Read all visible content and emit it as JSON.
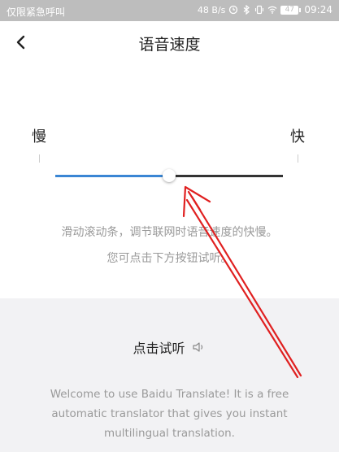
{
  "status_bar": {
    "carrier": "仅限紧急呼叫",
    "net_speed": "48 B/s",
    "battery": "47",
    "time": "09:24"
  },
  "header": {
    "title": "语音速度"
  },
  "slider": {
    "slow_label": "慢",
    "fast_label": "快",
    "value": 0.5,
    "fill_color": "#3a86d4",
    "track_color": "#333333"
  },
  "hint": {
    "line1": "滑动滚动条，调节联网时语音速度的快慢。",
    "line2": "您可点击下方按钮试听。"
  },
  "preview": {
    "button_label": "点击试听",
    "icon": "speaker-icon",
    "sample_text": "Welcome to use Baidu Translate! It is a free automatic translator that gives you instant multilingual translation."
  },
  "annotation": {
    "arrow_color": "#e02020"
  }
}
